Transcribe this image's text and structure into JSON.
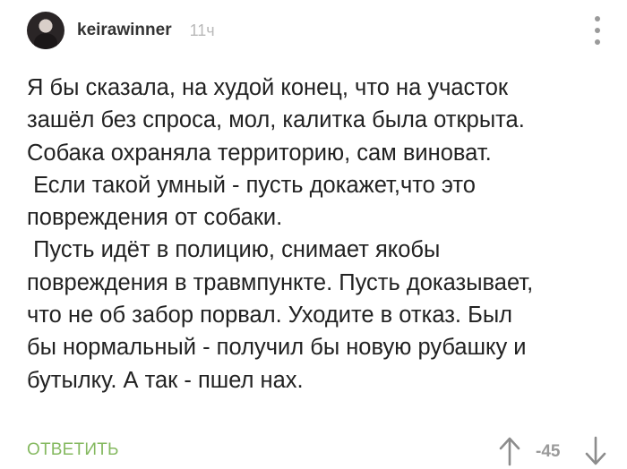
{
  "comment": {
    "author": "keirawinner",
    "time": "11ч",
    "text_lines": [
      "Я бы сказала, на худой конец, что на участок",
      "зашёл без спроса, мол, калитка была открыта.",
      "Собака охраняла территорию, сам виноват.",
      " Если такой умный - пусть докажет,что это",
      "повреждения от собаки.",
      " Пусть идёт в полицию, снимает якобы",
      "повреждения в травмпункте. Пусть доказывает,",
      "что не об забор порвал. Уходите в отказ. Был",
      "бы нормальный - получил бы новую рубашку и",
      "бутылку. А так - пшел нах."
    ],
    "reply_label": "ОТВЕТИТЬ",
    "rating": "-45"
  },
  "icons": {
    "menu": "more-vertical-icon",
    "upvote": "arrow-up-icon",
    "downvote": "arrow-down-icon"
  },
  "colors": {
    "reply": "#85b960",
    "muted": "#9a9a9a",
    "text": "#222222"
  }
}
